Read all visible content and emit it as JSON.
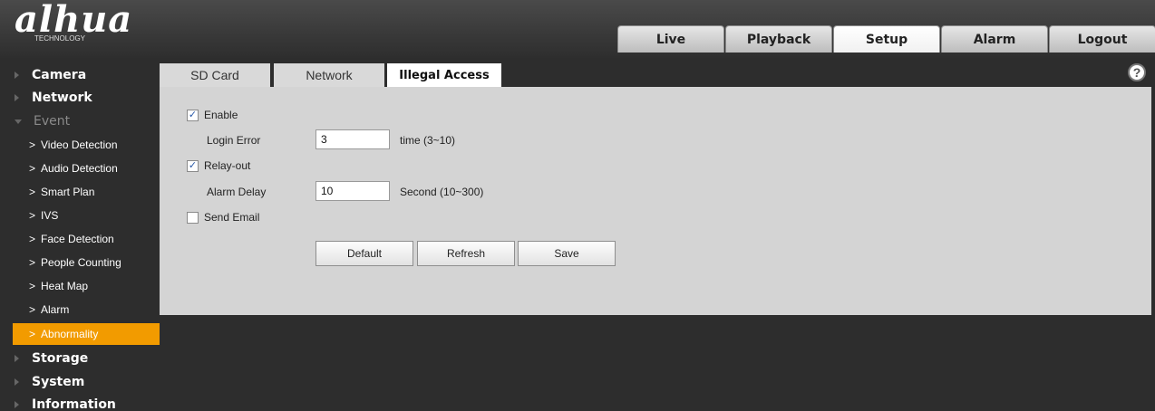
{
  "header": {
    "brand": "alhua",
    "brand_sub": "TECHNOLOGY",
    "nav": [
      "Live",
      "Playback",
      "Setup",
      "Alarm",
      "Logout"
    ],
    "active_nav": "Setup"
  },
  "sidebar": {
    "groups": [
      {
        "label": "Camera"
      },
      {
        "label": "Network"
      },
      {
        "label": "Event"
      },
      {
        "label": "Storage"
      },
      {
        "label": "System"
      },
      {
        "label": "Information"
      }
    ],
    "event_items": [
      {
        "label": "Video Detection"
      },
      {
        "label": "Audio Detection"
      },
      {
        "label": "Smart Plan"
      },
      {
        "label": "IVS"
      },
      {
        "label": "Face Detection"
      },
      {
        "label": "People Counting"
      },
      {
        "label": "Heat Map"
      },
      {
        "label": "Alarm"
      },
      {
        "label": "Abnormality"
      }
    ],
    "selected": "Abnormality",
    "accent": "#f29b00"
  },
  "content": {
    "tabs": [
      {
        "label": "SD Card"
      },
      {
        "label": "Network"
      },
      {
        "label": "Illegal Access"
      }
    ],
    "active_tab": "Illegal Access",
    "form": {
      "enable": {
        "label": "Enable",
        "checked": true
      },
      "login_error": {
        "label": "Login Error",
        "value": "3",
        "hint": "time (3~10)"
      },
      "relay_out": {
        "label": "Relay-out",
        "checked": true
      },
      "alarm_delay": {
        "label": "Alarm Delay",
        "value": "10",
        "hint": "Second (10~300)"
      },
      "send_email": {
        "label": "Send Email",
        "checked": false
      }
    },
    "buttons": {
      "default": "Default",
      "refresh": "Refresh",
      "save": "Save"
    },
    "help": "?"
  }
}
